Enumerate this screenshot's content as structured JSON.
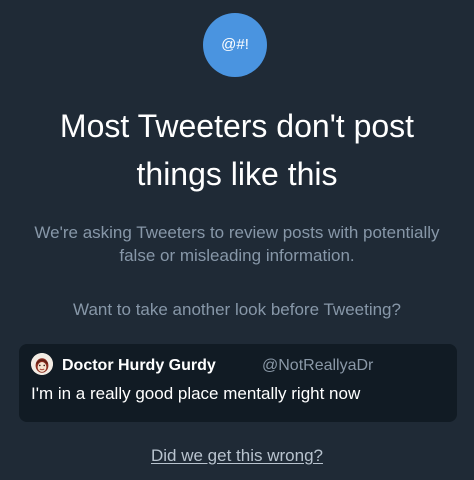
{
  "badge": {
    "label": "@#!"
  },
  "title": "Most Tweeters don't post things like this",
  "body": {
    "line_1": "We're asking Tweeters to review posts with potentially false or misleading information.",
    "line_2": "Want to take another look before Tweeting?"
  },
  "tweet": {
    "author_name": "Doctor Hurdy Gurdy",
    "handle": "@NotReallyaDr",
    "text": "I'm in a really good place mentally right now",
    "avatar_icon": "avatar-icon"
  },
  "footer": {
    "link_label": "Did we get this wrong?"
  },
  "colors": {
    "background": "#1f2a36",
    "badge": "#4a94e0",
    "card": "#111b24",
    "title": "#ffffff",
    "secondary": "#8797a8",
    "link": "#b8c3ce"
  }
}
